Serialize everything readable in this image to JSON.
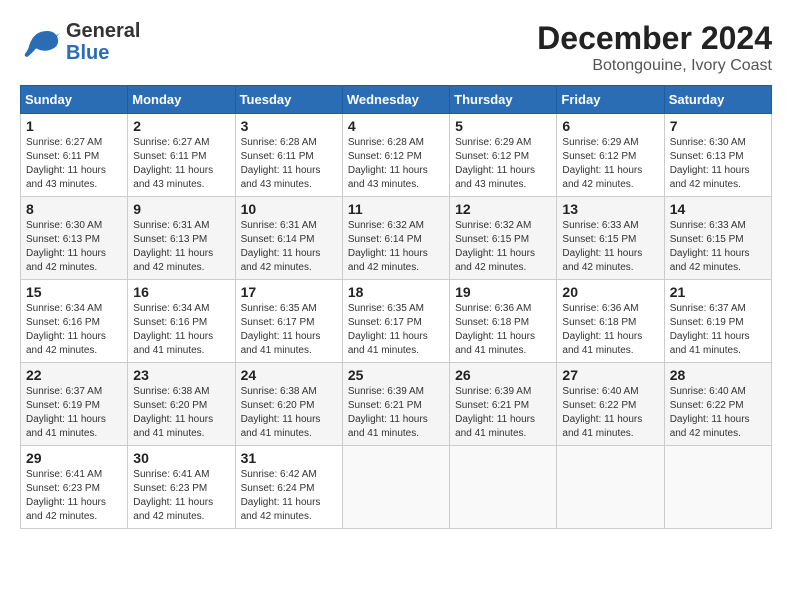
{
  "header": {
    "logo_general": "General",
    "logo_blue": "Blue",
    "month_title": "December 2024",
    "location": "Botongouine, Ivory Coast"
  },
  "weekdays": [
    "Sunday",
    "Monday",
    "Tuesday",
    "Wednesday",
    "Thursday",
    "Friday",
    "Saturday"
  ],
  "weeks": [
    [
      {
        "day": "1",
        "sunrise": "6:27 AM",
        "sunset": "6:11 PM",
        "daylight": "11 hours and 43 minutes."
      },
      {
        "day": "2",
        "sunrise": "6:27 AM",
        "sunset": "6:11 PM",
        "daylight": "11 hours and 43 minutes."
      },
      {
        "day": "3",
        "sunrise": "6:28 AM",
        "sunset": "6:11 PM",
        "daylight": "11 hours and 43 minutes."
      },
      {
        "day": "4",
        "sunrise": "6:28 AM",
        "sunset": "6:12 PM",
        "daylight": "11 hours and 43 minutes."
      },
      {
        "day": "5",
        "sunrise": "6:29 AM",
        "sunset": "6:12 PM",
        "daylight": "11 hours and 43 minutes."
      },
      {
        "day": "6",
        "sunrise": "6:29 AM",
        "sunset": "6:12 PM",
        "daylight": "11 hours and 42 minutes."
      },
      {
        "day": "7",
        "sunrise": "6:30 AM",
        "sunset": "6:13 PM",
        "daylight": "11 hours and 42 minutes."
      }
    ],
    [
      {
        "day": "8",
        "sunrise": "6:30 AM",
        "sunset": "6:13 PM",
        "daylight": "11 hours and 42 minutes."
      },
      {
        "day": "9",
        "sunrise": "6:31 AM",
        "sunset": "6:13 PM",
        "daylight": "11 hours and 42 minutes."
      },
      {
        "day": "10",
        "sunrise": "6:31 AM",
        "sunset": "6:14 PM",
        "daylight": "11 hours and 42 minutes."
      },
      {
        "day": "11",
        "sunrise": "6:32 AM",
        "sunset": "6:14 PM",
        "daylight": "11 hours and 42 minutes."
      },
      {
        "day": "12",
        "sunrise": "6:32 AM",
        "sunset": "6:15 PM",
        "daylight": "11 hours and 42 minutes."
      },
      {
        "day": "13",
        "sunrise": "6:33 AM",
        "sunset": "6:15 PM",
        "daylight": "11 hours and 42 minutes."
      },
      {
        "day": "14",
        "sunrise": "6:33 AM",
        "sunset": "6:15 PM",
        "daylight": "11 hours and 42 minutes."
      }
    ],
    [
      {
        "day": "15",
        "sunrise": "6:34 AM",
        "sunset": "6:16 PM",
        "daylight": "11 hours and 42 minutes."
      },
      {
        "day": "16",
        "sunrise": "6:34 AM",
        "sunset": "6:16 PM",
        "daylight": "11 hours and 41 minutes."
      },
      {
        "day": "17",
        "sunrise": "6:35 AM",
        "sunset": "6:17 PM",
        "daylight": "11 hours and 41 minutes."
      },
      {
        "day": "18",
        "sunrise": "6:35 AM",
        "sunset": "6:17 PM",
        "daylight": "11 hours and 41 minutes."
      },
      {
        "day": "19",
        "sunrise": "6:36 AM",
        "sunset": "6:18 PM",
        "daylight": "11 hours and 41 minutes."
      },
      {
        "day": "20",
        "sunrise": "6:36 AM",
        "sunset": "6:18 PM",
        "daylight": "11 hours and 41 minutes."
      },
      {
        "day": "21",
        "sunrise": "6:37 AM",
        "sunset": "6:19 PM",
        "daylight": "11 hours and 41 minutes."
      }
    ],
    [
      {
        "day": "22",
        "sunrise": "6:37 AM",
        "sunset": "6:19 PM",
        "daylight": "11 hours and 41 minutes."
      },
      {
        "day": "23",
        "sunrise": "6:38 AM",
        "sunset": "6:20 PM",
        "daylight": "11 hours and 41 minutes."
      },
      {
        "day": "24",
        "sunrise": "6:38 AM",
        "sunset": "6:20 PM",
        "daylight": "11 hours and 41 minutes."
      },
      {
        "day": "25",
        "sunrise": "6:39 AM",
        "sunset": "6:21 PM",
        "daylight": "11 hours and 41 minutes."
      },
      {
        "day": "26",
        "sunrise": "6:39 AM",
        "sunset": "6:21 PM",
        "daylight": "11 hours and 41 minutes."
      },
      {
        "day": "27",
        "sunrise": "6:40 AM",
        "sunset": "6:22 PM",
        "daylight": "11 hours and 41 minutes."
      },
      {
        "day": "28",
        "sunrise": "6:40 AM",
        "sunset": "6:22 PM",
        "daylight": "11 hours and 42 minutes."
      }
    ],
    [
      {
        "day": "29",
        "sunrise": "6:41 AM",
        "sunset": "6:23 PM",
        "daylight": "11 hours and 42 minutes."
      },
      {
        "day": "30",
        "sunrise": "6:41 AM",
        "sunset": "6:23 PM",
        "daylight": "11 hours and 42 minutes."
      },
      {
        "day": "31",
        "sunrise": "6:42 AM",
        "sunset": "6:24 PM",
        "daylight": "11 hours and 42 minutes."
      },
      null,
      null,
      null,
      null
    ]
  ],
  "labels": {
    "sunrise": "Sunrise:",
    "sunset": "Sunset:",
    "daylight": "Daylight:"
  }
}
